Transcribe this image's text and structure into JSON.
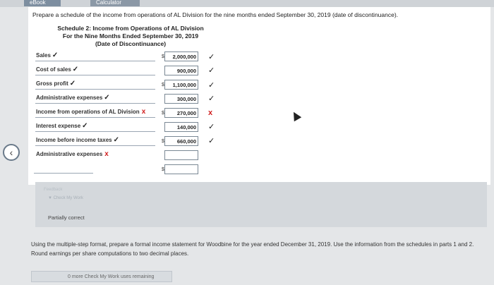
{
  "tabs": {
    "ebook": "eBook",
    "calculator": "Calculator"
  },
  "prompt": "Prepare a schedule of the income from operations of AL Division for the nine months ended September 30, 2019 (date of discontinuance).",
  "schedule": {
    "title": "Schedule 2: Income from Operations of AL Division",
    "subtitle": "For the Nine Months Ended September 30, 2019",
    "date_line": "(Date of Discontinuance)",
    "currency": "$",
    "rows": [
      {
        "label": "Sales",
        "value": "2,000,000",
        "label_mark": "✓",
        "result": "correct"
      },
      {
        "label": "Cost of sales",
        "value": "900,000",
        "label_mark": "✓",
        "result": "correct"
      },
      {
        "label": "Gross profit",
        "value": "1,100,000",
        "label_mark": "✓",
        "result": "correct"
      },
      {
        "label": "Administrative expenses",
        "value": "300,000",
        "label_mark": "✓",
        "result": "correct"
      },
      {
        "label": "Income from operations of AL Division",
        "value": "270,000",
        "label_mark": "x",
        "result": "incorrect"
      },
      {
        "label": "Interest expense",
        "value": "140,000",
        "label_mark": "✓",
        "result": "correct"
      },
      {
        "label": "Income before income taxes",
        "value": "660,000",
        "label_mark": "✓",
        "result": "correct"
      },
      {
        "label": "Administrative expenses",
        "value": "",
        "label_mark": "x",
        "result": ""
      },
      {
        "label": "",
        "value": "",
        "label_mark": "",
        "result": ""
      }
    ],
    "result_marks": {
      "correct": "✓",
      "incorrect": "x"
    }
  },
  "back_icon": "chevron-left-icon",
  "feedback": {
    "title": "Feedback",
    "check_label": "Check My Work",
    "status": "Partially correct"
  },
  "question": "Using the multiple-step format, prepare a formal income statement for Woodbine for the year ended December 31, 2019. Use the information from the schedules in parts 1 and 2. Round earnings per share computations to two decimal places.",
  "check_note": "0 more Check My Work uses remaining"
}
